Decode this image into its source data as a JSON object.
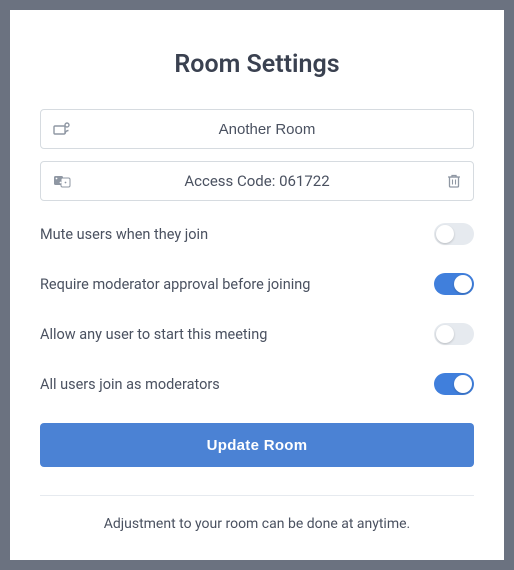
{
  "modal": {
    "title": "Room Settings",
    "room_name": "Another Room",
    "access_code_label": "Access Code: 061722",
    "settings": [
      {
        "label": "Mute users when they join",
        "on": false
      },
      {
        "label": "Require moderator approval before joining",
        "on": true
      },
      {
        "label": "Allow any user to start this meeting",
        "on": false
      },
      {
        "label": "All users join as moderators",
        "on": true
      }
    ],
    "update_button": "Update Room",
    "footer": "Adjustment to your room can be done at anytime."
  },
  "colors": {
    "accent": "#4b82d4",
    "toggle_on": "#407fdc",
    "toggle_off": "#e6eaef",
    "text": "#4a5160"
  }
}
